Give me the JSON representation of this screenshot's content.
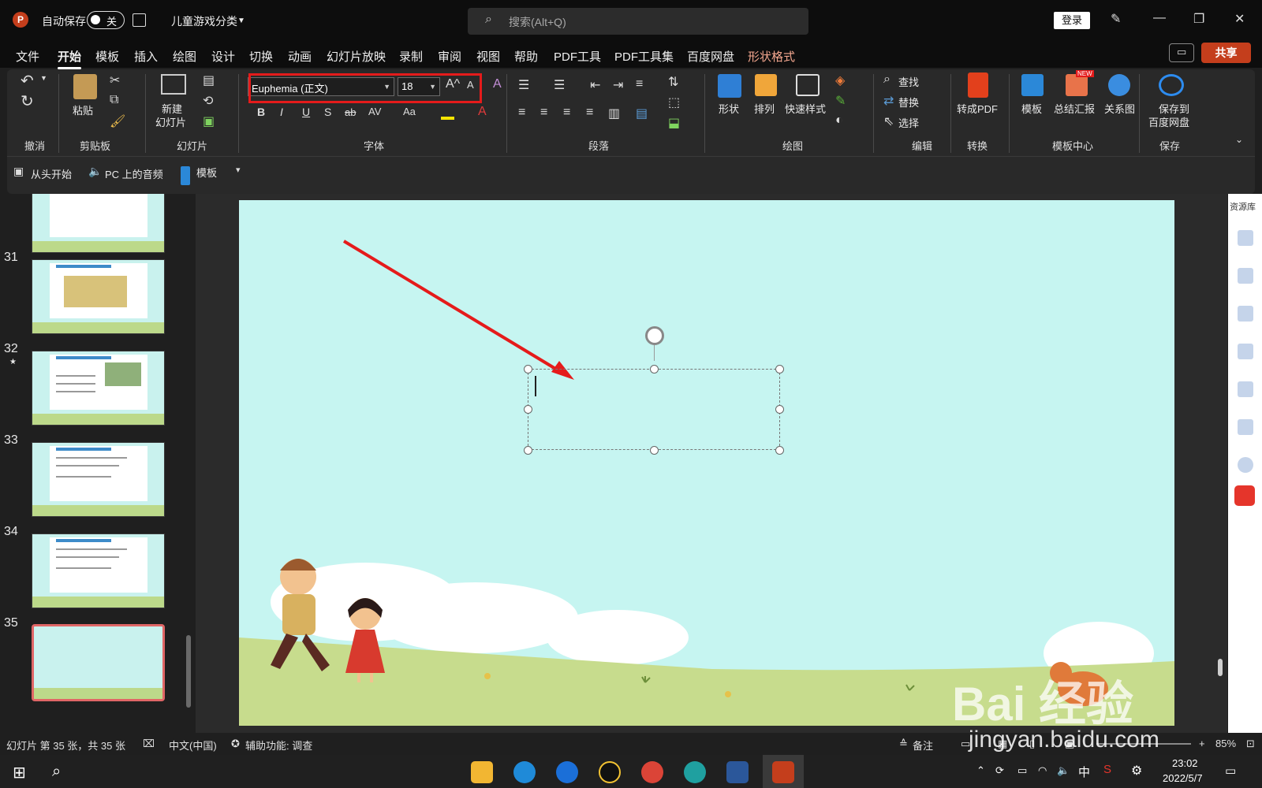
{
  "titlebar": {
    "autosave_label": "自动保存",
    "autosave_state": "关",
    "doc_title": "儿童游戏分类",
    "search_placeholder": "搜索(Alt+Q)",
    "login_label": "登录"
  },
  "menu": {
    "tabs": [
      "文件",
      "开始",
      "模板",
      "插入",
      "绘图",
      "设计",
      "切换",
      "动画",
      "幻灯片放映",
      "录制",
      "审阅",
      "视图",
      "帮助",
      "PDF工具",
      "PDF工具集",
      "百度网盘",
      "形状格式"
    ],
    "active": "开始",
    "share_label": "共享"
  },
  "ribbon": {
    "groups": [
      "撤消",
      "剪贴板",
      "幻灯片",
      "字体",
      "段落",
      "绘图",
      "编辑",
      "转换",
      "模板中心",
      "保存"
    ],
    "paste_label": "粘贴",
    "new_slide_label_1": "新建",
    "new_slide_label_2": "幻灯片",
    "font_name": "Euphemia (正文)",
    "font_size": "18",
    "shape_label": "形状",
    "arrange_label": "排列",
    "quick_style_label": "快速样式",
    "find_label": "查找",
    "replace_label": "替换",
    "select_label": "选择",
    "to_pdf_label": "转成PDF",
    "template_label": "模板",
    "summary_label": "总结汇报",
    "relation_label": "关系图",
    "save_to_label_1": "保存到",
    "save_to_label_2": "百度网盘",
    "new_badge": "NEW",
    "format_glyphs": [
      "B",
      "I",
      "U",
      "S",
      "ab",
      "AV",
      "Aa"
    ]
  },
  "qat": {
    "from_start": "从头开始",
    "pc_audio": "PC 上的音频",
    "template": "模板"
  },
  "thumbnails": [
    {
      "num": "31"
    },
    {
      "num": "32",
      "star": "★"
    },
    {
      "num": "33"
    },
    {
      "num": "34"
    },
    {
      "num": "35"
    }
  ],
  "right_panel": {
    "title": "资源库"
  },
  "status": {
    "slide_info": "幻灯片 第 35 张，共 35 张",
    "language": "中文(中国)",
    "accessibility": "辅助功能: 调查",
    "notes": "备注",
    "zoom": "85%"
  },
  "taskbar": {
    "ime": "中",
    "time": "23:02",
    "date": "2022/5/7"
  },
  "watermark": {
    "brand": "Bai 经验",
    "url": "jingyan.baidu.com"
  },
  "colors": {
    "slide_bg": "#c6f5f1",
    "grass": "#c7dc8d",
    "highlight": "#e51b1b",
    "share": "#c43e1c"
  }
}
